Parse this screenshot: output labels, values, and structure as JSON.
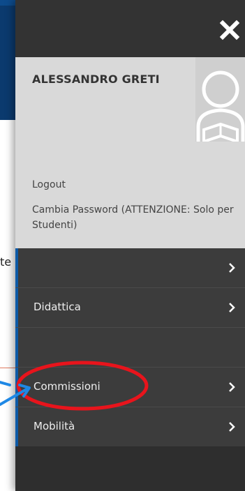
{
  "background": {
    "partial_text": "te c"
  },
  "drawer": {
    "close_icon": "close-icon",
    "profile": {
      "name": "ALESSANDRO GRETI",
      "avatar_icon": "user-avatar-icon",
      "logout_label": "Logout",
      "change_password_label": "Cambia Password (ATTENZIONE: Solo per Studenti)"
    },
    "menu": [
      {
        "label": "",
        "chevron": "chevron-right-icon"
      },
      {
        "label": "Didattica",
        "chevron": "chevron-right-icon"
      },
      {
        "label": "",
        "chevron": ""
      },
      {
        "label": "Commissioni",
        "chevron": "chevron-right-icon"
      },
      {
        "label": "Mobilità",
        "chevron": "chevron-right-icon"
      }
    ]
  },
  "colors": {
    "drawer_bg": "#3c3c3c",
    "profile_bg": "#d9d9d9",
    "accent_blue": "#0d5aa7",
    "annotation_red": "#e8141c",
    "annotation_arrow_blue": "#1e88e5"
  }
}
